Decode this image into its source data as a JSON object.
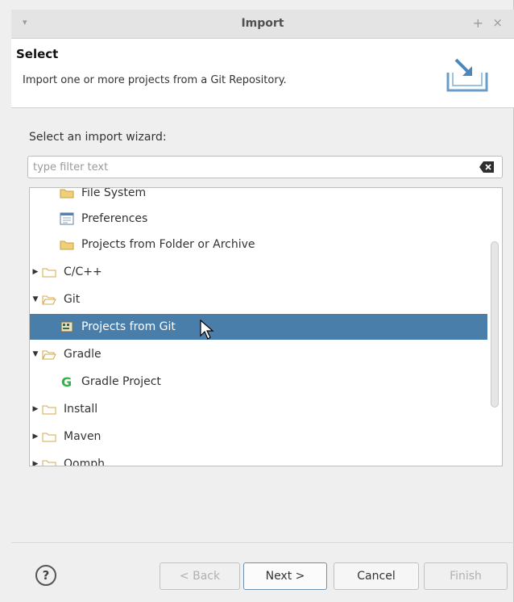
{
  "window": {
    "title": "Import",
    "plus_glyph": "+",
    "close_glyph": "×",
    "menu_glyph": "▾"
  },
  "banner": {
    "heading": "Select",
    "description": "Import one or more projects from a Git Repository."
  },
  "body": {
    "section_label": "Select an import wizard:",
    "filter_placeholder": "type filter text"
  },
  "tree": {
    "items": [
      {
        "label": "File System",
        "icon": "folder-icon",
        "expanded": null,
        "selected": false,
        "indent": 2
      },
      {
        "label": "Preferences",
        "icon": "preferences-icon",
        "expanded": null,
        "selected": false,
        "indent": 2
      },
      {
        "label": "Projects from Folder or Archive",
        "icon": "folder-icon",
        "expanded": null,
        "selected": false,
        "indent": 2
      },
      {
        "label": "C/C++",
        "icon": "folder-icon",
        "expanded": false,
        "selected": false,
        "indent": 1
      },
      {
        "label": "Git",
        "icon": "folder-icon",
        "expanded": true,
        "selected": false,
        "indent": 1
      },
      {
        "label": "Projects from Git",
        "icon": "git-project-icon",
        "expanded": null,
        "selected": true,
        "indent": 2
      },
      {
        "label": "Gradle",
        "icon": "folder-icon",
        "expanded": true,
        "selected": false,
        "indent": 1
      },
      {
        "label": "Gradle Project",
        "icon": "gradle-icon",
        "expanded": null,
        "selected": false,
        "indent": 2
      },
      {
        "label": "Install",
        "icon": "folder-icon",
        "expanded": false,
        "selected": false,
        "indent": 1
      },
      {
        "label": "Maven",
        "icon": "folder-icon",
        "expanded": false,
        "selected": false,
        "indent": 1
      },
      {
        "label": "Oomph",
        "icon": "folder-icon",
        "expanded": false,
        "selected": false,
        "indent": 1
      }
    ]
  },
  "footer": {
    "help_glyph": "?",
    "back_label": "< Back",
    "next_label": "Next >",
    "cancel_label": "Cancel",
    "finish_label": "Finish"
  },
  "colors": {
    "selection": "#4a7eaa",
    "folder": "#e9c46a",
    "gradle_green": "#2fb344"
  }
}
